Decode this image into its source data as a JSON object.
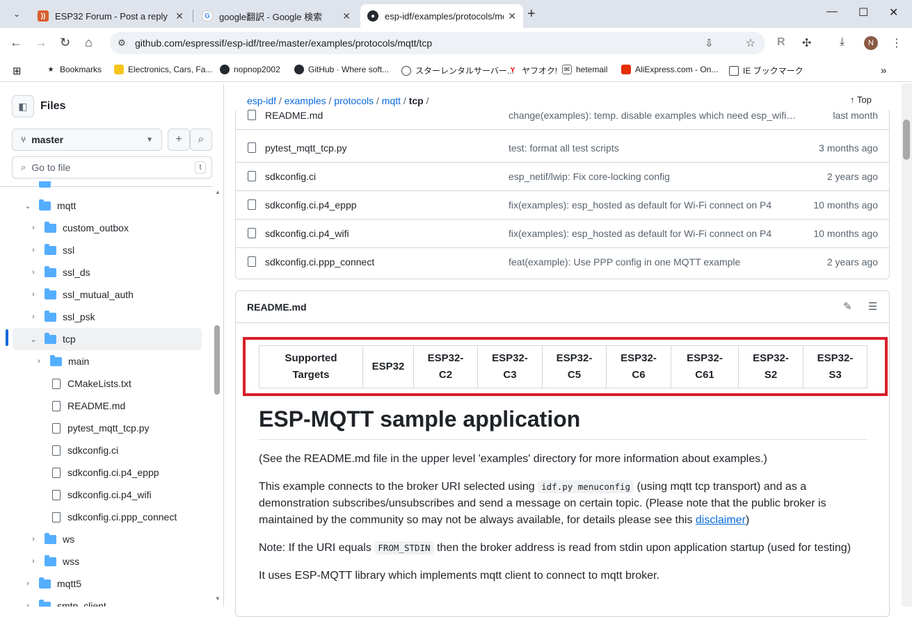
{
  "browser": {
    "tabs": [
      {
        "title": "ESP32 Forum - Post a reply",
        "fav_color": "#d95c2b"
      },
      {
        "title": "google翻訳 - Google 検索",
        "fav_color": "#4285f4"
      },
      {
        "title": "esp-idf/examples/protocols/mq",
        "fav_color": "#24292f"
      }
    ],
    "new_tab": "+",
    "url": "github.com/espressif/esp-idf/tree/master/examples/protocols/mqtt/tcp",
    "avatar_initial": "N",
    "bookmarks": [
      "Bookmarks",
      "Electronics, Cars, Fa...",
      "nopnop2002",
      "GitHub · Where soft...",
      "スターレンタルサーバー...",
      "ヤフオク!",
      "hetemail",
      "AliExpress.com - On...",
      "IE ブックマーク"
    ]
  },
  "sidebar": {
    "title": "Files",
    "branch": "master",
    "search_placeholder": "Go to file",
    "search_shortcut": "t",
    "tree": [
      {
        "label": "mqtt",
        "type": "folder",
        "open": true,
        "depth": 0
      },
      {
        "label": "custom_outbox",
        "type": "folder",
        "open": false,
        "depth": 1
      },
      {
        "label": "ssl",
        "type": "folder",
        "open": false,
        "depth": 1
      },
      {
        "label": "ssl_ds",
        "type": "folder",
        "open": false,
        "depth": 1
      },
      {
        "label": "ssl_mutual_auth",
        "type": "folder",
        "open": false,
        "depth": 1
      },
      {
        "label": "ssl_psk",
        "type": "folder",
        "open": false,
        "depth": 1
      },
      {
        "label": "tcp",
        "type": "folder",
        "open": true,
        "depth": 1,
        "selected": true
      },
      {
        "label": "main",
        "type": "folder",
        "open": false,
        "depth": 2
      },
      {
        "label": "CMakeLists.txt",
        "type": "file",
        "depth": 2
      },
      {
        "label": "README.md",
        "type": "file",
        "depth": 2
      },
      {
        "label": "pytest_mqtt_tcp.py",
        "type": "file",
        "depth": 2
      },
      {
        "label": "sdkconfig.ci",
        "type": "file",
        "depth": 2
      },
      {
        "label": "sdkconfig.ci.p4_eppp",
        "type": "file",
        "depth": 2
      },
      {
        "label": "sdkconfig.ci.p4_wifi",
        "type": "file",
        "depth": 2
      },
      {
        "label": "sdkconfig.ci.ppp_connect",
        "type": "file",
        "depth": 2
      },
      {
        "label": "ws",
        "type": "folder",
        "open": false,
        "depth": 1
      },
      {
        "label": "wss",
        "type": "folder",
        "open": false,
        "depth": 1
      },
      {
        "label": "mqtt5",
        "type": "folder",
        "open": false,
        "depth": 0
      },
      {
        "label": "smtp_client",
        "type": "folder",
        "open": false,
        "depth": 0
      }
    ]
  },
  "main": {
    "breadcrumb": [
      "esp-idf",
      "examples",
      "protocols",
      "mqtt",
      "tcp"
    ],
    "top_label": "Top",
    "files": [
      {
        "name": "README.md",
        "commit": "change(examples): temp. disable examples which need esp_wifi_remote",
        "time": "last month"
      },
      {
        "name": "pytest_mqtt_tcp.py",
        "commit": "test: format all test scripts",
        "time": "3 months ago"
      },
      {
        "name": "sdkconfig.ci",
        "commit": "esp_netif/lwip: Fix core-locking config",
        "time": "2 years ago"
      },
      {
        "name": "sdkconfig.ci.p4_eppp",
        "commit": "fix(examples): esp_hosted as default for Wi-Fi connect on P4",
        "time": "10 months ago"
      },
      {
        "name": "sdkconfig.ci.p4_wifi",
        "commit": "fix(examples): esp_hosted as default for Wi-Fi connect on P4",
        "time": "10 months ago"
      },
      {
        "name": "sdkconfig.ci.ppp_connect",
        "commit": "feat(example): Use PPP config in one MQTT example",
        "time": "2 years ago"
      }
    ],
    "readme": {
      "filename": "README.md",
      "targets": [
        "Supported Targets",
        "ESP32",
        "ESP32-C2",
        "ESP32-C3",
        "ESP32-C5",
        "ESP32-C6",
        "ESP32-C61",
        "ESP32-S2",
        "ESP32-S3"
      ],
      "heading": "ESP-MQTT sample application",
      "p1": "(See the README.md file in the upper level 'examples' directory for more information about examples.)",
      "p2_a": "This example connects to the broker URI selected using",
      "p2_code": "idf.py menuconfig",
      "p2_b": "(using mqtt tcp transport) and as a demonstration subscribes/unsubscribes and send a message on certain topic. (Please note that the public broker is maintained by the community so may not be always available, for details please see this",
      "p2_link": "disclaimer",
      "p2_c": ")",
      "p3_a": "Note: If the URI equals",
      "p3_code": "FROM_STDIN",
      "p3_b": "then the broker address is read from stdin upon application startup (used for testing)",
      "p4": "It uses ESP-MQTT library which implements mqtt client to connect to mqtt broker."
    }
  }
}
